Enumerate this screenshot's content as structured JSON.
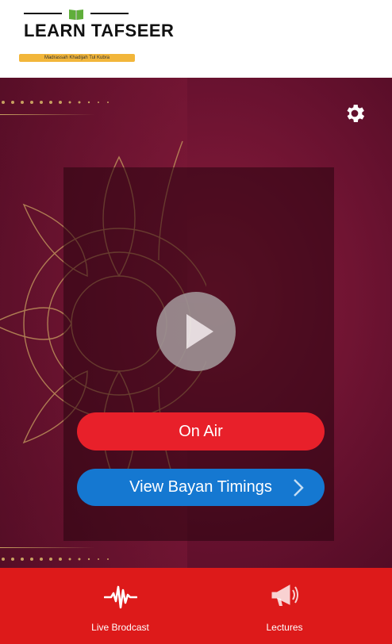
{
  "header": {
    "logo_title": "LEARN TAFSEER",
    "logo_tagline": "Madrassah Khadijah Tul Kubra"
  },
  "player": {
    "on_air_label": "On Air",
    "timings_label": "View Bayan Timings"
  },
  "tabs": [
    {
      "label": "Live Brodcast",
      "icon": "waveform-icon"
    },
    {
      "label": "Lectures",
      "icon": "megaphone-icon"
    }
  ],
  "colors": {
    "background": "#6a1230",
    "on_air": "#e8202a",
    "timings": "#1578d1",
    "tabbar": "#dd1a1a",
    "accent_gold": "#c8a060"
  }
}
